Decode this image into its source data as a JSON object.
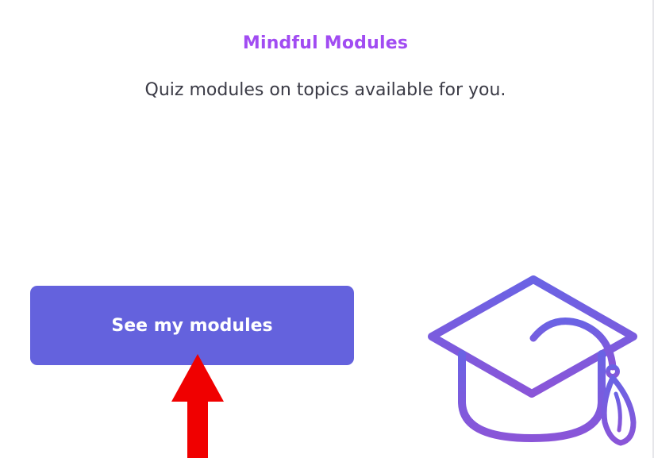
{
  "card": {
    "title": "Mindful Modules",
    "subtitle": "Quiz modules on topics available for you.",
    "cta_label": "See my modules"
  },
  "icons": {
    "illustration": "graduation-cap-icon",
    "annotation": "red-up-arrow"
  },
  "colors": {
    "title": "#a14cf2",
    "subtitle": "#3b3b46",
    "button": "#6462dd",
    "button_text": "#ffffff",
    "cap_stroke": "#7a5ce0",
    "annotation_arrow": "#f00000"
  }
}
